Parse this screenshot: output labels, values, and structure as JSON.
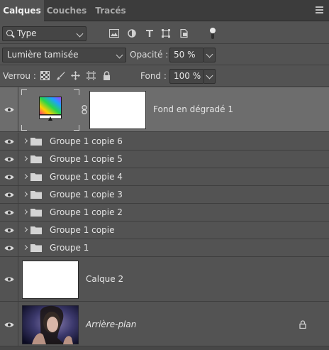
{
  "tabs": [
    {
      "label": "Calques",
      "active": true
    },
    {
      "label": "Couches",
      "active": false
    },
    {
      "label": "Tracés",
      "active": false
    }
  ],
  "panel_menu_icon": "hamburger-menu-icon",
  "filter": {
    "kind_value": "Type",
    "kind_icon": "search-icon",
    "filter_icons": [
      "pixel-layer-filter-icon",
      "adjustment-layer-filter-icon",
      "type-layer-filter-icon",
      "shape-layer-filter-icon",
      "smart-object-filter-icon"
    ],
    "toggle_on": true
  },
  "blend": {
    "mode_value": "Lumière tamisée",
    "opacity_label": "Opacité :",
    "opacity_value": "50 %"
  },
  "lock": {
    "label": "Verrou :",
    "icons": [
      "lock-transparency-icon",
      "lock-image-icon",
      "lock-position-icon",
      "lock-artboard-icon",
      "lock-all-icon"
    ],
    "fill_label": "Fond :",
    "fill_value": "100 %"
  },
  "layers": [
    {
      "name": "Fond en dégradé 1",
      "type": "gradient-fill",
      "selected": true,
      "visible": true
    },
    {
      "name": "Groupe 1 copie 6",
      "type": "group",
      "visible": true
    },
    {
      "name": "Groupe 1 copie 5",
      "type": "group",
      "visible": true
    },
    {
      "name": "Groupe 1 copie 4",
      "type": "group",
      "visible": true
    },
    {
      "name": "Groupe 1 copie 3",
      "type": "group",
      "visible": true
    },
    {
      "name": "Groupe 1 copie 2",
      "type": "group",
      "visible": true
    },
    {
      "name": "Groupe 1 copie",
      "type": "group",
      "visible": true
    },
    {
      "name": "Groupe 1",
      "type": "group",
      "visible": true
    },
    {
      "name": "Calque 2",
      "type": "pixel",
      "visible": true
    },
    {
      "name": "Arrière-plan",
      "type": "background",
      "visible": true,
      "locked": true
    }
  ],
  "colors": {
    "panel_bg": "#535353",
    "selected_row": "#6d6d6d",
    "tabbar_bg": "#3c3c3c"
  }
}
